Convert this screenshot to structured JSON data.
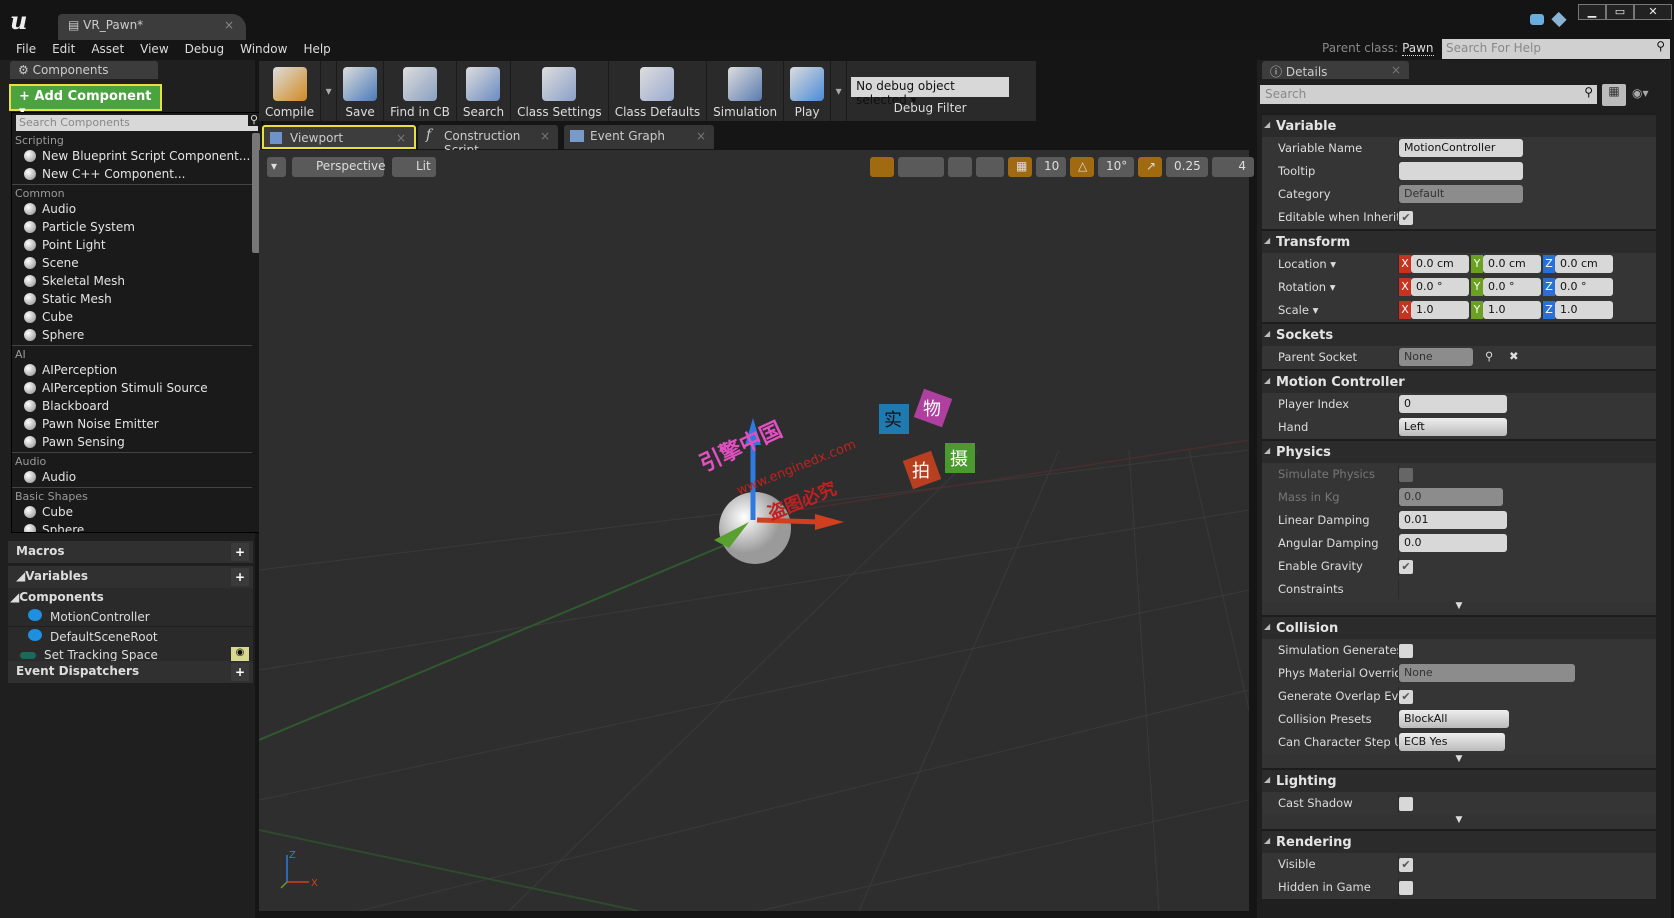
{
  "window": {
    "tab_title": "VR_Pawn*",
    "parent_class_label": "Parent class:",
    "parent_class": "Pawn",
    "help_search_placeholder": "Search For Help"
  },
  "menu": [
    "File",
    "Edit",
    "Asset",
    "View",
    "Debug",
    "Window",
    "Help"
  ],
  "components_panel": {
    "tab": "Components",
    "add_button": "+ Add Component ▾",
    "search_placeholder": "Search Components",
    "categories": [
      {
        "name": "Scripting",
        "items": [
          "New Blueprint Script Component...",
          "New C++ Component..."
        ]
      },
      {
        "name": "Common",
        "items": [
          "Audio",
          "Particle System",
          "Point Light",
          "Scene",
          "Skeletal Mesh",
          "Static Mesh",
          "Cube",
          "Sphere"
        ]
      },
      {
        "name": "AI",
        "items": [
          "AIPerception",
          "AIPerception Stimuli Source",
          "Blackboard",
          "Pawn Noise Emitter",
          "Pawn Sensing"
        ]
      },
      {
        "name": "Audio",
        "items": [
          "Audio"
        ]
      },
      {
        "name": "Basic Shapes",
        "items": [
          "Cube",
          "Sphere"
        ]
      }
    ]
  },
  "my_blueprint": {
    "macros": "Macros",
    "variables": "Variables",
    "components": "Components",
    "component_items": [
      "MotionController",
      "DefaultSceneRoot"
    ],
    "set_tracking_space": "Set Tracking Space",
    "event_dispatchers": "Event Dispatchers"
  },
  "toolbar": {
    "buttons": [
      "Compile",
      "Save",
      "Find in CB",
      "Search",
      "Class Settings",
      "Class Defaults",
      "Simulation",
      "Play"
    ],
    "debug_select": "No debug object selected ▾",
    "debug_label": "Debug Filter"
  },
  "editor_tabs": [
    "Viewport",
    "Construction Script",
    "Event Graph"
  ],
  "viewport": {
    "view_mode": "Perspective",
    "lighting": "Lit",
    "grid_snap": "10",
    "rotation_snap": "10°",
    "scale_snap": "0.25",
    "camera_speed": "4",
    "axis_z": "Z",
    "axis_x": "X",
    "watermark": {
      "site_cn": "引擎中国",
      "url": "www.enginedx.com",
      "notice": "盗图必究",
      "stamp": [
        "实",
        "物",
        "拍",
        "摄"
      ]
    }
  },
  "details": {
    "tab": "Details",
    "search_placeholder": "Search",
    "colors": {
      "x": "#c8321e",
      "y": "#6aa121",
      "z": "#2a6fd6"
    },
    "variable": {
      "title": "Variable",
      "name_label": "Variable Name",
      "name": "MotionController",
      "tooltip_label": "Tooltip",
      "tooltip": "",
      "category_label": "Category",
      "category": "Default",
      "editable_label": "Editable when Inherited",
      "editable": true
    },
    "transform": {
      "title": "Transform",
      "location_label": "Location ▾",
      "location": [
        "0.0 cm",
        "0.0 cm",
        "0.0 cm"
      ],
      "rotation_label": "Rotation ▾",
      "rotation": [
        "0.0 °",
        "0.0 °",
        "0.0 °"
      ],
      "scale_label": "Scale ▾",
      "scale": [
        "1.0",
        "1.0",
        "1.0"
      ]
    },
    "sockets": {
      "title": "Sockets",
      "parent_socket_label": "Parent Socket",
      "parent_socket": "None"
    },
    "motion_controller": {
      "title": "Motion Controller",
      "player_index_label": "Player Index",
      "player_index": "0",
      "hand_label": "Hand",
      "hand": "Left"
    },
    "physics": {
      "title": "Physics",
      "simulate_label": "Simulate Physics",
      "simulate": false,
      "mass_label": "Mass in Kg",
      "mass": "0.0",
      "linear_label": "Linear Damping",
      "linear": "0.01",
      "angular_label": "Angular Damping",
      "angular": "0.0",
      "gravity_label": "Enable Gravity",
      "gravity": true,
      "constraints_label": "Constraints"
    },
    "collision": {
      "title": "Collision",
      "sim_hit_label": "Simulation Generates H",
      "sim_hit": false,
      "phys_mat_label": "Phys Material Override",
      "phys_mat": "None",
      "overlap_label": "Generate Overlap Event",
      "overlap": true,
      "presets_label": "Collision Presets",
      "presets": "BlockAll",
      "step_up_label": "Can Character Step Up (",
      "step_up": "ECB Yes"
    },
    "lighting": {
      "title": "Lighting",
      "cast_shadow_label": "Cast Shadow",
      "cast_shadow": false
    },
    "rendering": {
      "title": "Rendering",
      "visible_label": "Visible",
      "visible": true,
      "hidden_label": "Hidden in Game",
      "hidden": false
    }
  }
}
